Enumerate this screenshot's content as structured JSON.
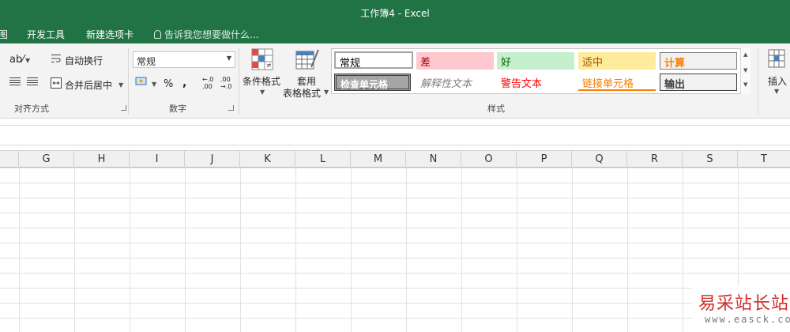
{
  "window": {
    "title": "工作簿4 - Excel"
  },
  "tabs": [
    {
      "label": "图"
    },
    {
      "label": "开发工具"
    },
    {
      "label": "新建选项卡"
    }
  ],
  "tell_me": {
    "placeholder": "告诉我您想要做什么..."
  },
  "ribbon": {
    "alignment": {
      "wrap_text": "自动换行",
      "merge_center": "合并后居中",
      "label": "对齐方式"
    },
    "number": {
      "format_value": "常规",
      "percent": "%",
      "comma": ",",
      "increase_decimal": "←.0\n.00",
      "decrease_decimal": ".00\n→.0",
      "label": "数字"
    },
    "styles": {
      "conditional_formatting": "条件格式",
      "format_as_table_line1": "套用",
      "format_as_table_line2": "表格格式",
      "gallery": [
        {
          "label": "常规",
          "fg": "#000000",
          "bg": "#ffffff"
        },
        {
          "label": "差",
          "fg": "#9c0006",
          "bg": "#ffc7ce"
        },
        {
          "label": "好",
          "fg": "#006100",
          "bg": "#c6efce"
        },
        {
          "label": "适中",
          "fg": "#9c5700",
          "bg": "#ffeb9c"
        },
        {
          "label": "计算",
          "fg": "#fa7d00",
          "bg": "#f2f2f2"
        },
        {
          "label": "检查单元格",
          "fg": "#ffffff",
          "bg": "#a5a5a5"
        },
        {
          "label": "解释性文本",
          "fg": "#7f7f7f",
          "bg": "#ffffff"
        },
        {
          "label": "警告文本",
          "fg": "#ff0000",
          "bg": "#ffffff"
        },
        {
          "label": "链接单元格",
          "fg": "#fa7d00",
          "bg": "#ffffff"
        },
        {
          "label": "输出",
          "fg": "#3f3f3f",
          "bg": "#f2f2f2"
        }
      ],
      "label": "样式"
    },
    "cells": {
      "insert": "插入"
    }
  },
  "grid": {
    "columns": [
      "G",
      "H",
      "I",
      "J",
      "K",
      "L",
      "M",
      "N",
      "O",
      "P",
      "Q",
      "R",
      "S",
      "T"
    ]
  },
  "watermark": {
    "main": "易采站长站",
    "url": "www.easck.com"
  },
  "colors": {
    "accent": "#217346"
  }
}
